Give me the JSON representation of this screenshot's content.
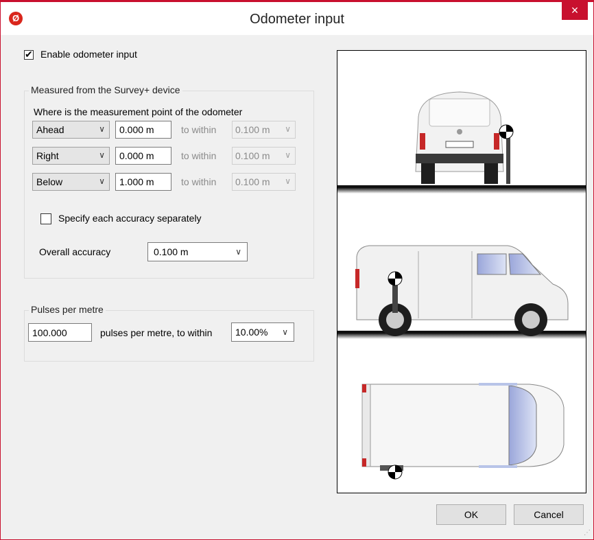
{
  "window": {
    "title": "Odometer input",
    "close_symbol": "×",
    "app_icon_glyph": "Ø"
  },
  "enable": {
    "label": "Enable odometer input",
    "checked": true
  },
  "measured": {
    "legend": "Measured from the Survey+ device",
    "question": "Where is the measurement point of the odometer",
    "rows": [
      {
        "direction": "Ahead",
        "value": "0.000 m",
        "within_label": "to within",
        "accuracy": "0.100 m"
      },
      {
        "direction": "Right",
        "value": "0.000 m",
        "within_label": "to within",
        "accuracy": "0.100 m"
      },
      {
        "direction": "Below",
        "value": "1.000 m",
        "within_label": "to within",
        "accuracy": "0.100 m"
      }
    ],
    "separate_label": "Specify each accuracy separately",
    "separate_checked": false,
    "overall_label": "Overall accuracy",
    "overall_value": "0.100 m"
  },
  "pulses": {
    "legend": "Pulses per metre",
    "value": "100.000",
    "label": "pulses per metre, to within",
    "tolerance": "10.00%"
  },
  "buttons": {
    "ok": "OK",
    "cancel": "Cancel"
  },
  "colors": {
    "accent": "#c8102e",
    "marker_black": "#000000",
    "van_body": "#f4f4f4",
    "window_glass": "#b8c4e8"
  }
}
